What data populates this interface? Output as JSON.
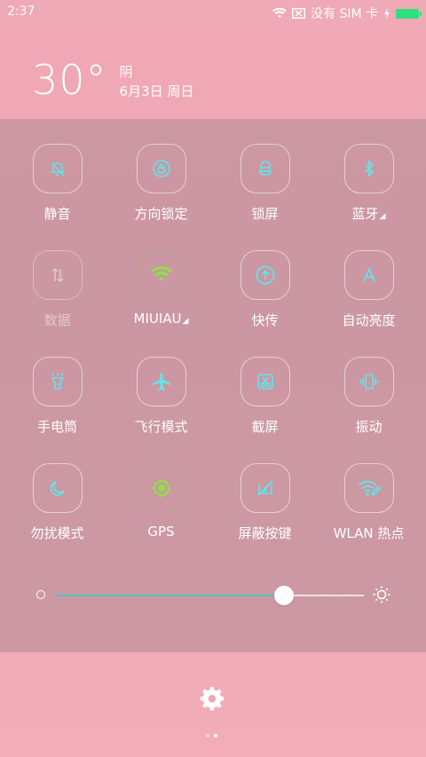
{
  "status_bar": {
    "time": "2:37",
    "sim_text": "没有 SIM 卡",
    "battery_color": "#2fe07e"
  },
  "weather": {
    "temperature": "30°",
    "condition": "阴",
    "date": "6月3日 周日"
  },
  "toggles": [
    {
      "label": "静音",
      "icon": "bell-off-icon",
      "state": "off"
    },
    {
      "label": "方向锁定",
      "icon": "rotation-lock-icon",
      "state": "off"
    },
    {
      "label": "锁屏",
      "icon": "lock-icon",
      "state": "off"
    },
    {
      "label": "蓝牙",
      "icon": "bluetooth-icon",
      "state": "off",
      "has_menu": true
    },
    {
      "label": "数据",
      "icon": "data-arrows-icon",
      "state": "disabled"
    },
    {
      "label": "MIUIAU",
      "icon": "wifi-icon",
      "state": "on",
      "has_menu": true
    },
    {
      "label": "快传",
      "icon": "quick-transfer-icon",
      "state": "off"
    },
    {
      "label": "自动亮度",
      "icon": "auto-brightness-icon",
      "state": "off"
    },
    {
      "label": "手电筒",
      "icon": "flashlight-icon",
      "state": "off"
    },
    {
      "label": "飞行模式",
      "icon": "airplane-icon",
      "state": "off"
    },
    {
      "label": "截屏",
      "icon": "screenshot-icon",
      "state": "off"
    },
    {
      "label": "振动",
      "icon": "vibrate-icon",
      "state": "off"
    },
    {
      "label": "勿扰模式",
      "icon": "moon-icon",
      "state": "off"
    },
    {
      "label": "GPS",
      "icon": "gps-icon",
      "state": "on"
    },
    {
      "label": "屏蔽按键",
      "icon": "block-keys-icon",
      "state": "off"
    },
    {
      "label": "WLAN 热点",
      "icon": "hotspot-icon",
      "state": "off"
    }
  ],
  "brightness": {
    "level": 0.74,
    "accent_color": "#4cc4c4"
  },
  "colors": {
    "icon_accent": "#5fe6ee",
    "active_green": "#8fe04a"
  },
  "pager": {
    "total": 2,
    "current": 2
  }
}
